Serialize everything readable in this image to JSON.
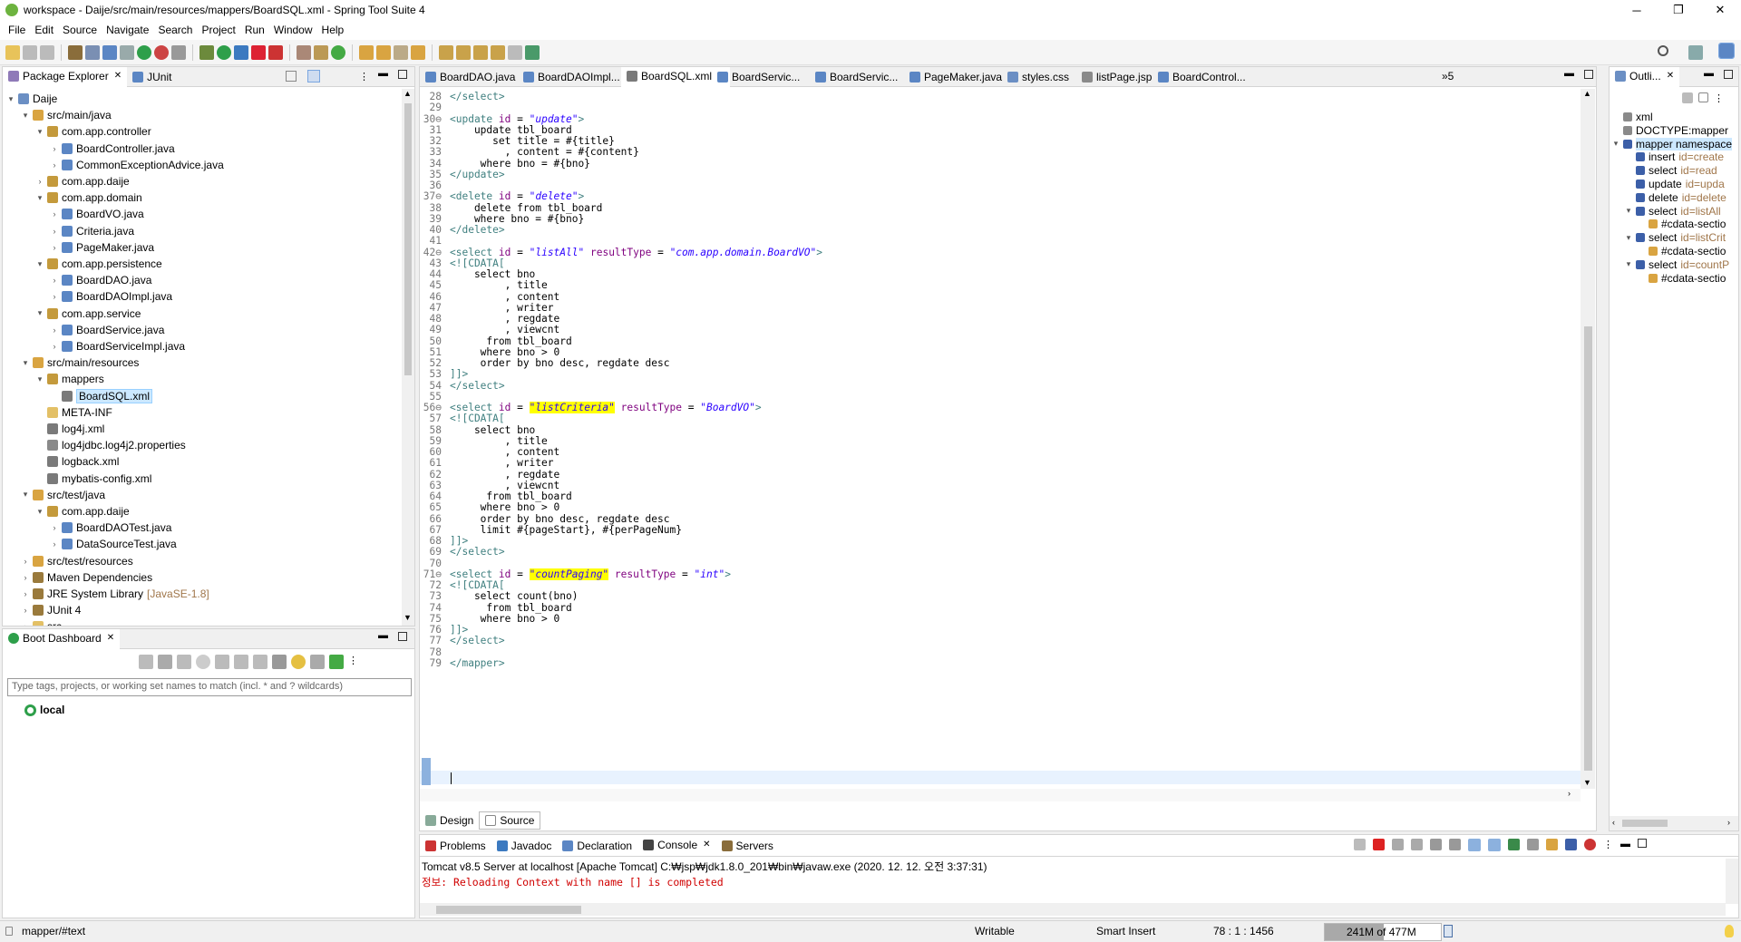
{
  "window": {
    "title": "workspace - Daije/src/main/resources/mappers/BoardSQL.xml - Spring Tool Suite 4",
    "controls": [
      "─",
      "❐",
      "✕"
    ]
  },
  "menu": [
    "File",
    "Edit",
    "Source",
    "Navigate",
    "Search",
    "Project",
    "Run",
    "Window",
    "Help"
  ],
  "left_panel": {
    "tabs": [
      "Package Explorer",
      "JUnit"
    ],
    "tree": [
      {
        "label": "Daije",
        "level": 0,
        "twisty": "▾",
        "icon": "project-icon"
      },
      {
        "label": "src/main/java",
        "level": 1,
        "twisty": "▾",
        "icon": "source-folder-icon"
      },
      {
        "label": "com.app.controller",
        "level": 2,
        "twisty": "▾",
        "icon": "package-icon"
      },
      {
        "label": "BoardController.java",
        "level": 3,
        "twisty": "›",
        "icon": "java-file-icon"
      },
      {
        "label": "CommonExceptionAdvice.java",
        "level": 3,
        "twisty": "›",
        "icon": "java-file-icon"
      },
      {
        "label": "com.app.daije",
        "level": 2,
        "twisty": "›",
        "icon": "package-icon"
      },
      {
        "label": "com.app.domain",
        "level": 2,
        "twisty": "▾",
        "icon": "package-icon"
      },
      {
        "label": "BoardVO.java",
        "level": 3,
        "twisty": "›",
        "icon": "java-file-icon"
      },
      {
        "label": "Criteria.java",
        "level": 3,
        "twisty": "›",
        "icon": "java-file-icon"
      },
      {
        "label": "PageMaker.java",
        "level": 3,
        "twisty": "›",
        "icon": "java-file-icon"
      },
      {
        "label": "com.app.persistence",
        "level": 2,
        "twisty": "▾",
        "icon": "package-icon"
      },
      {
        "label": "BoardDAO.java",
        "level": 3,
        "twisty": "›",
        "icon": "java-file-icon"
      },
      {
        "label": "BoardDAOImpl.java",
        "level": 3,
        "twisty": "›",
        "icon": "java-file-icon"
      },
      {
        "label": "com.app.service",
        "level": 2,
        "twisty": "▾",
        "icon": "package-icon"
      },
      {
        "label": "BoardService.java",
        "level": 3,
        "twisty": "›",
        "icon": "java-file-icon"
      },
      {
        "label": "BoardServiceImpl.java",
        "level": 3,
        "twisty": "›",
        "icon": "java-file-icon"
      },
      {
        "label": "src/main/resources",
        "level": 1,
        "twisty": "▾",
        "icon": "source-folder-icon"
      },
      {
        "label": "mappers",
        "level": 2,
        "twisty": "▾",
        "icon": "package-icon"
      },
      {
        "label": "BoardSQL.xml",
        "level": 3,
        "twisty": "",
        "icon": "xml-file-icon",
        "selected": true
      },
      {
        "label": "META-INF",
        "level": 2,
        "twisty": "",
        "icon": "folder-icon"
      },
      {
        "label": "log4j.xml",
        "level": 2,
        "twisty": "",
        "icon": "xml-file-icon"
      },
      {
        "label": "log4jdbc.log4j2.properties",
        "level": 2,
        "twisty": "",
        "icon": "properties-file-icon"
      },
      {
        "label": "logback.xml",
        "level": 2,
        "twisty": "",
        "icon": "xml-file-icon"
      },
      {
        "label": "mybatis-config.xml",
        "level": 2,
        "twisty": "",
        "icon": "xml-file-icon"
      },
      {
        "label": "src/test/java",
        "level": 1,
        "twisty": "▾",
        "icon": "source-folder-icon"
      },
      {
        "label": "com.app.daije",
        "level": 2,
        "twisty": "▾",
        "icon": "package-icon"
      },
      {
        "label": "BoardDAOTest.java",
        "level": 3,
        "twisty": "›",
        "icon": "java-file-icon"
      },
      {
        "label": "DataSourceTest.java",
        "level": 3,
        "twisty": "›",
        "icon": "java-file-icon"
      },
      {
        "label": "src/test/resources",
        "level": 1,
        "twisty": "›",
        "icon": "source-folder-icon"
      },
      {
        "label": "Maven Dependencies",
        "level": 1,
        "twisty": "›",
        "icon": "library-icon"
      },
      {
        "label": "JRE System Library",
        "level": 1,
        "twisty": "›",
        "icon": "library-icon",
        "suffix": "[JavaSE-1.8]"
      },
      {
        "label": "JUnit 4",
        "level": 1,
        "twisty": "›",
        "icon": "library-icon"
      },
      {
        "label": "src",
        "level": 1,
        "twisty": "›",
        "icon": "folder-icon"
      }
    ]
  },
  "boot_dashboard": {
    "tab": "Boot Dashboard",
    "filter_placeholder": "Type tags, projects, or working set names to match (incl. * and ? wildcards)",
    "local": "local"
  },
  "editor": {
    "tabs": [
      "BoardDAO.java",
      "BoardDAOImpl...",
      "BoardSQL.xml",
      "BoardServic...",
      "BoardServic...",
      "PageMaker.java",
      "styles.css",
      "listPage.jsp",
      "BoardControl..."
    ],
    "overflow": "»5",
    "active_tab": 2,
    "lines": [
      {
        "n": "28",
        "t": "</select>"
      },
      {
        "n": "29",
        "t": ""
      },
      {
        "n": "30⊖",
        "t": "<update id = \"update\">"
      },
      {
        "n": "31",
        "t": "    update tbl_board"
      },
      {
        "n": "32",
        "t": "       set title = #{title}"
      },
      {
        "n": "33",
        "t": "         , content = #{content}"
      },
      {
        "n": "34",
        "t": "     where bno = #{bno}"
      },
      {
        "n": "35",
        "t": "</update>"
      },
      {
        "n": "36",
        "t": ""
      },
      {
        "n": "37⊖",
        "t": "<delete id = \"delete\">"
      },
      {
        "n": "38",
        "t": "    delete from tbl_board"
      },
      {
        "n": "39",
        "t": "    where bno = #{bno}"
      },
      {
        "n": "40",
        "t": "</delete>"
      },
      {
        "n": "41",
        "t": ""
      },
      {
        "n": "42⊖",
        "t": "<select id = \"listAll\" resultType = \"com.app.domain.BoardVO\">"
      },
      {
        "n": "43",
        "t": "<![CDATA["
      },
      {
        "n": "44",
        "t": "    select bno"
      },
      {
        "n": "45",
        "t": "         , title"
      },
      {
        "n": "46",
        "t": "         , content"
      },
      {
        "n": "47",
        "t": "         , writer"
      },
      {
        "n": "48",
        "t": "         , regdate"
      },
      {
        "n": "49",
        "t": "         , viewcnt"
      },
      {
        "n": "50",
        "t": "      from tbl_board"
      },
      {
        "n": "51",
        "t": "     where bno > 0"
      },
      {
        "n": "52",
        "t": "     order by bno desc, regdate desc"
      },
      {
        "n": "53",
        "t": "]]>"
      },
      {
        "n": "54",
        "t": "</select>"
      },
      {
        "n": "55",
        "t": ""
      },
      {
        "n": "56⊖",
        "t": "<select id = \"listCriteria\" resultType = \"BoardVO\">"
      },
      {
        "n": "57",
        "t": "<![CDATA["
      },
      {
        "n": "58",
        "t": "    select bno"
      },
      {
        "n": "59",
        "t": "         , title"
      },
      {
        "n": "60",
        "t": "         , content"
      },
      {
        "n": "61",
        "t": "         , writer"
      },
      {
        "n": "62",
        "t": "         , regdate"
      },
      {
        "n": "63",
        "t": "         , viewcnt"
      },
      {
        "n": "64",
        "t": "      from tbl_board"
      },
      {
        "n": "65",
        "t": "     where bno > 0"
      },
      {
        "n": "66",
        "t": "     order by bno desc, regdate desc"
      },
      {
        "n": "67",
        "t": "     limit #{pageStart}, #{perPageNum}"
      },
      {
        "n": "68",
        "t": "]]>"
      },
      {
        "n": "69",
        "t": "</select>"
      },
      {
        "n": "70",
        "t": ""
      },
      {
        "n": "71⊖",
        "t": "<select id = \"countPaging\" resultType = \"int\">"
      },
      {
        "n": "72",
        "t": "<![CDATA["
      },
      {
        "n": "73",
        "t": "    select count(bno)"
      },
      {
        "n": "74",
        "t": "      from tbl_board"
      },
      {
        "n": "75",
        "t": "     where bno > 0"
      },
      {
        "n": "76",
        "t": "]]>"
      },
      {
        "n": "77",
        "t": "</select>"
      },
      {
        "n": "78",
        "t": ""
      },
      {
        "n": "79",
        "t": "</mapper>"
      }
    ],
    "bottom_tabs": [
      "Design",
      "Source"
    ]
  },
  "outline": {
    "tab": "Outli...",
    "items": [
      {
        "label": "xml",
        "attr": "",
        "level": 0,
        "icon": "pi-icon"
      },
      {
        "label": "DOCTYPE:mapper",
        "attr": "",
        "level": 0,
        "icon": "doctype-icon"
      },
      {
        "label": "mapper namespace",
        "attr": "",
        "level": 0,
        "icon": "element-icon",
        "twisty": "▾",
        "selected": true
      },
      {
        "label": "insert",
        "attr": "id=create",
        "level": 1,
        "icon": "element-icon"
      },
      {
        "label": "select",
        "attr": "id=read",
        "level": 1,
        "icon": "element-icon"
      },
      {
        "label": "update",
        "attr": "id=upda",
        "level": 1,
        "icon": "element-icon"
      },
      {
        "label": "delete",
        "attr": "id=delete",
        "level": 1,
        "icon": "element-icon"
      },
      {
        "label": "select",
        "attr": "id=listAll",
        "level": 1,
        "icon": "element-icon",
        "twisty": "▾"
      },
      {
        "label": "#cdata-sectio",
        "attr": "",
        "level": 2,
        "icon": "cdata-icon"
      },
      {
        "label": "select",
        "attr": "id=listCrit",
        "level": 1,
        "icon": "element-icon",
        "twisty": "▾"
      },
      {
        "label": "#cdata-sectio",
        "attr": "",
        "level": 2,
        "icon": "cdata-icon"
      },
      {
        "label": "select",
        "attr": "id=countP",
        "level": 1,
        "icon": "element-icon",
        "twisty": "▾"
      },
      {
        "label": "#cdata-sectio",
        "attr": "",
        "level": 2,
        "icon": "cdata-icon"
      }
    ]
  },
  "console": {
    "tabs": [
      "Problems",
      "Javadoc",
      "Declaration",
      "Console",
      "Servers"
    ],
    "header": "Tomcat v8.5 Server at localhost [Apache Tomcat] C:₩jsp₩jdk1.8.0_201₩bin₩javaw.exe  (2020. 12. 12. 오전 3:37:31)",
    "line": "정보: Reloading Context with name [] is completed"
  },
  "status": {
    "path": "mapper/#text",
    "writable": "Writable",
    "insert_mode": "Smart Insert",
    "position": "78 : 1 : 1456",
    "memory": "241M of 477M"
  },
  "colors": {
    "tag": "#3f7f7f",
    "attr": "#7f007f",
    "value": "#2a00ff",
    "highlight": "#ffff00",
    "error_text": "#d00000"
  }
}
